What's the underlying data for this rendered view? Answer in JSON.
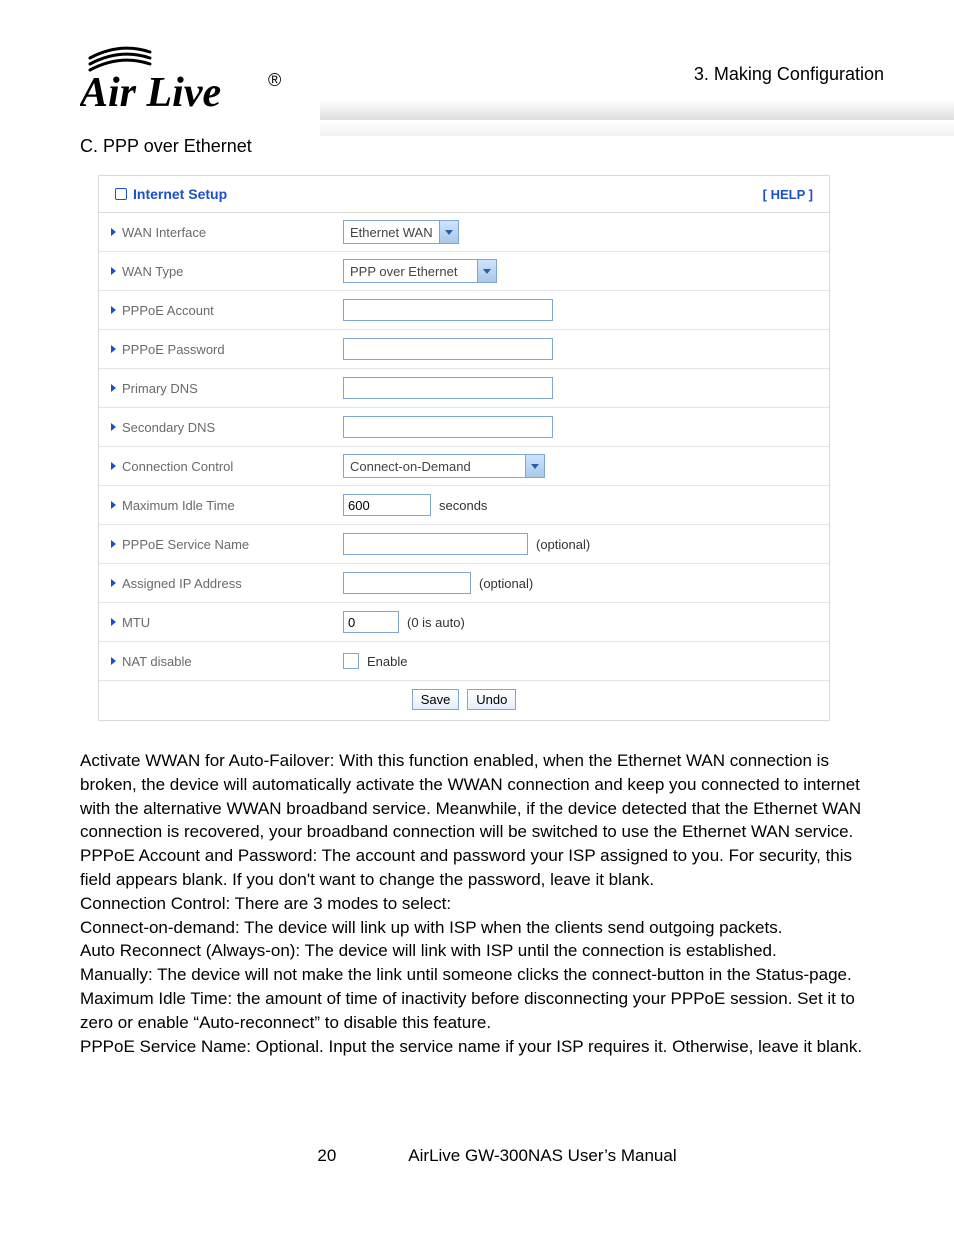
{
  "header": {
    "breadcrumb": "3.  Making  Configuration"
  },
  "section": {
    "title": "C. PPP over Ethernet"
  },
  "panel": {
    "title": "Internet Setup",
    "help": "[ HELP ]",
    "rows": {
      "wan_interface": {
        "label": "WAN Interface",
        "value": "Ethernet WAN"
      },
      "wan_type": {
        "label": "WAN Type",
        "value": "PPP over Ethernet"
      },
      "pppoe_account": {
        "label": "PPPoE Account",
        "value": ""
      },
      "pppoe_password": {
        "label": "PPPoE Password",
        "value": ""
      },
      "primary_dns": {
        "label": "Primary DNS",
        "value": ""
      },
      "secondary_dns": {
        "label": "Secondary DNS",
        "value": ""
      },
      "connection_control": {
        "label": "Connection Control",
        "value": "Connect-on-Demand"
      },
      "max_idle": {
        "label": "Maximum Idle Time",
        "value": "600",
        "suffix": "seconds"
      },
      "service_name": {
        "label": "PPPoE Service Name",
        "value": "",
        "hint": "(optional)"
      },
      "assigned_ip": {
        "label": "Assigned IP Address",
        "value": "",
        "hint": "(optional)"
      },
      "mtu": {
        "label": "MTU",
        "value": "0",
        "hint": "(0 is auto)"
      },
      "nat_disable": {
        "label": "NAT disable",
        "checkbox_label": "Enable"
      }
    },
    "buttons": {
      "save": "Save",
      "undo": "Undo"
    }
  },
  "body": {
    "p1": "Activate WWAN for Auto-Failover: With this function enabled, when the Ethernet WAN connection is broken, the device will automatically activate the WWAN connection and keep you connected to internet with the alternative WWAN broadband service. Meanwhile, if the device detected that the Ethernet WAN connection is recovered, your broadband connection will be switched to use the Ethernet WAN service.",
    "p2": "PPPoE Account and Password: The account and password your ISP assigned to you. For security, this field appears blank. If you don't want to change the password, leave it blank.",
    "p3": "Connection Control: There are 3 modes to select:",
    "p4": "Connect-on-demand: The device will link up with ISP when the clients send outgoing packets.",
    "p5": "Auto Reconnect (Always-on): The device will link with ISP until the connection is established.",
    "p6": "Manually: The device will not make the link until someone clicks the connect-button in the Status-page.",
    "p7": "Maximum Idle Time: the amount of time of inactivity before disconnecting your PPPoE session. Set it to zero or enable “Auto-reconnect” to disable this feature.",
    "p8": "PPPoE Service Name: Optional. Input the service name if your ISP requires it. Otherwise, leave it blank."
  },
  "footer": {
    "page": "20",
    "manual": "AirLive GW-300NAS User’s Manual"
  }
}
